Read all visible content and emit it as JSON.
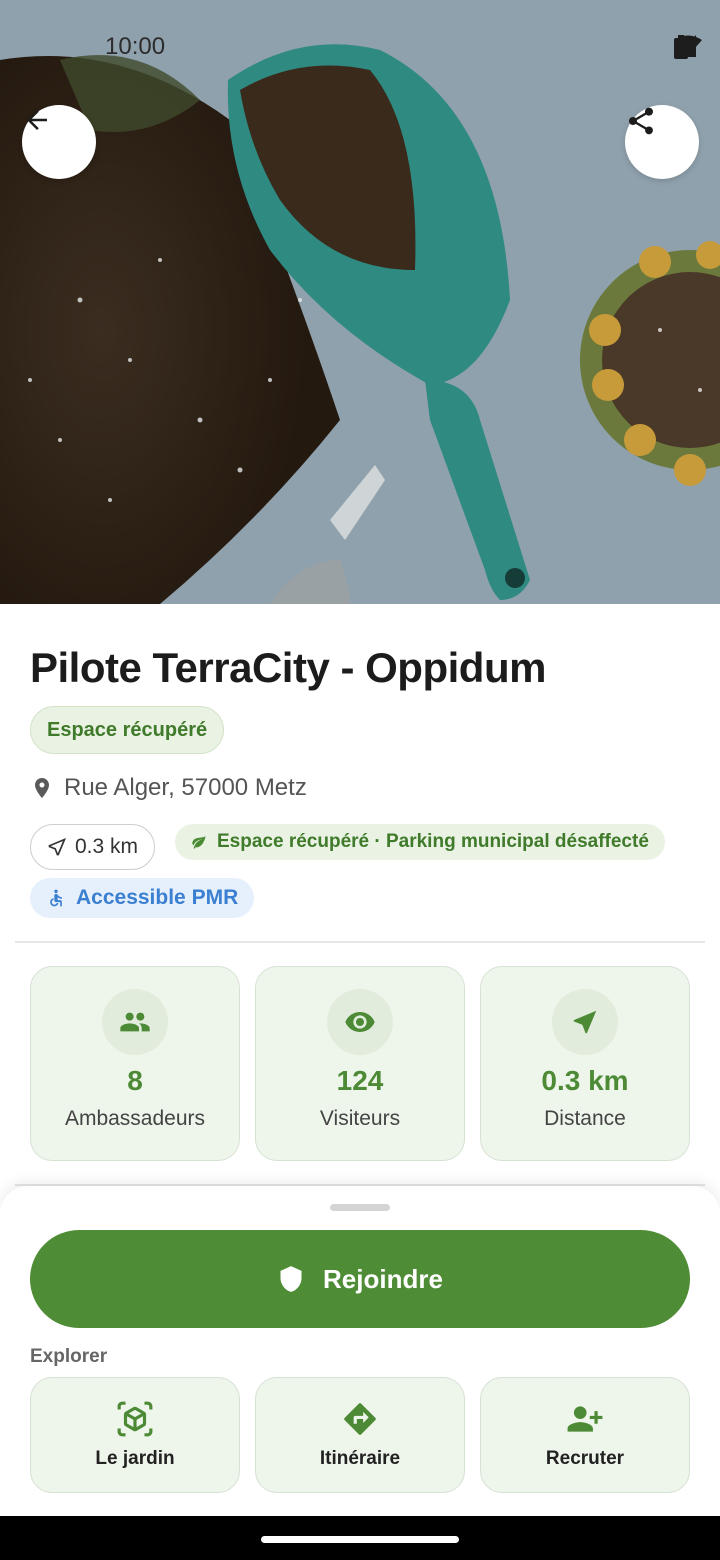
{
  "status_bar": {
    "time": "10:00"
  },
  "header": {
    "back_icon": "arrow-left-icon",
    "share_icon": "share-icon"
  },
  "place": {
    "title": "Pilote TerraCity - Oppidum",
    "type_label": "Espace récupéré",
    "address": "Rue Alger, 57000 Metz",
    "distance": "0.3 km",
    "space_detail": "Espace récupéré · Parking municipal désaffecté",
    "accessibility": "Accessible PMR"
  },
  "stats": [
    {
      "icon": "people-icon",
      "value": "8",
      "label": "Ambassadeurs"
    },
    {
      "icon": "eye-icon",
      "value": "124",
      "label": "Visiteurs"
    },
    {
      "icon": "navigation-icon",
      "value": "0.3 km",
      "label": "Distance"
    }
  ],
  "sheet": {
    "join_label": "Rejoindre",
    "explore_label": "Explorer",
    "actions": [
      {
        "icon": "view-in-ar-icon",
        "label": "Le jardin"
      },
      {
        "icon": "directions-icon",
        "label": "Itinéraire"
      },
      {
        "icon": "person-add-icon",
        "label": "Recruter"
      }
    ]
  },
  "colors": {
    "primary": "#4f8c36",
    "chip_green_bg": "#e9f2e3",
    "pmr_blue": "#3b7fd1"
  }
}
